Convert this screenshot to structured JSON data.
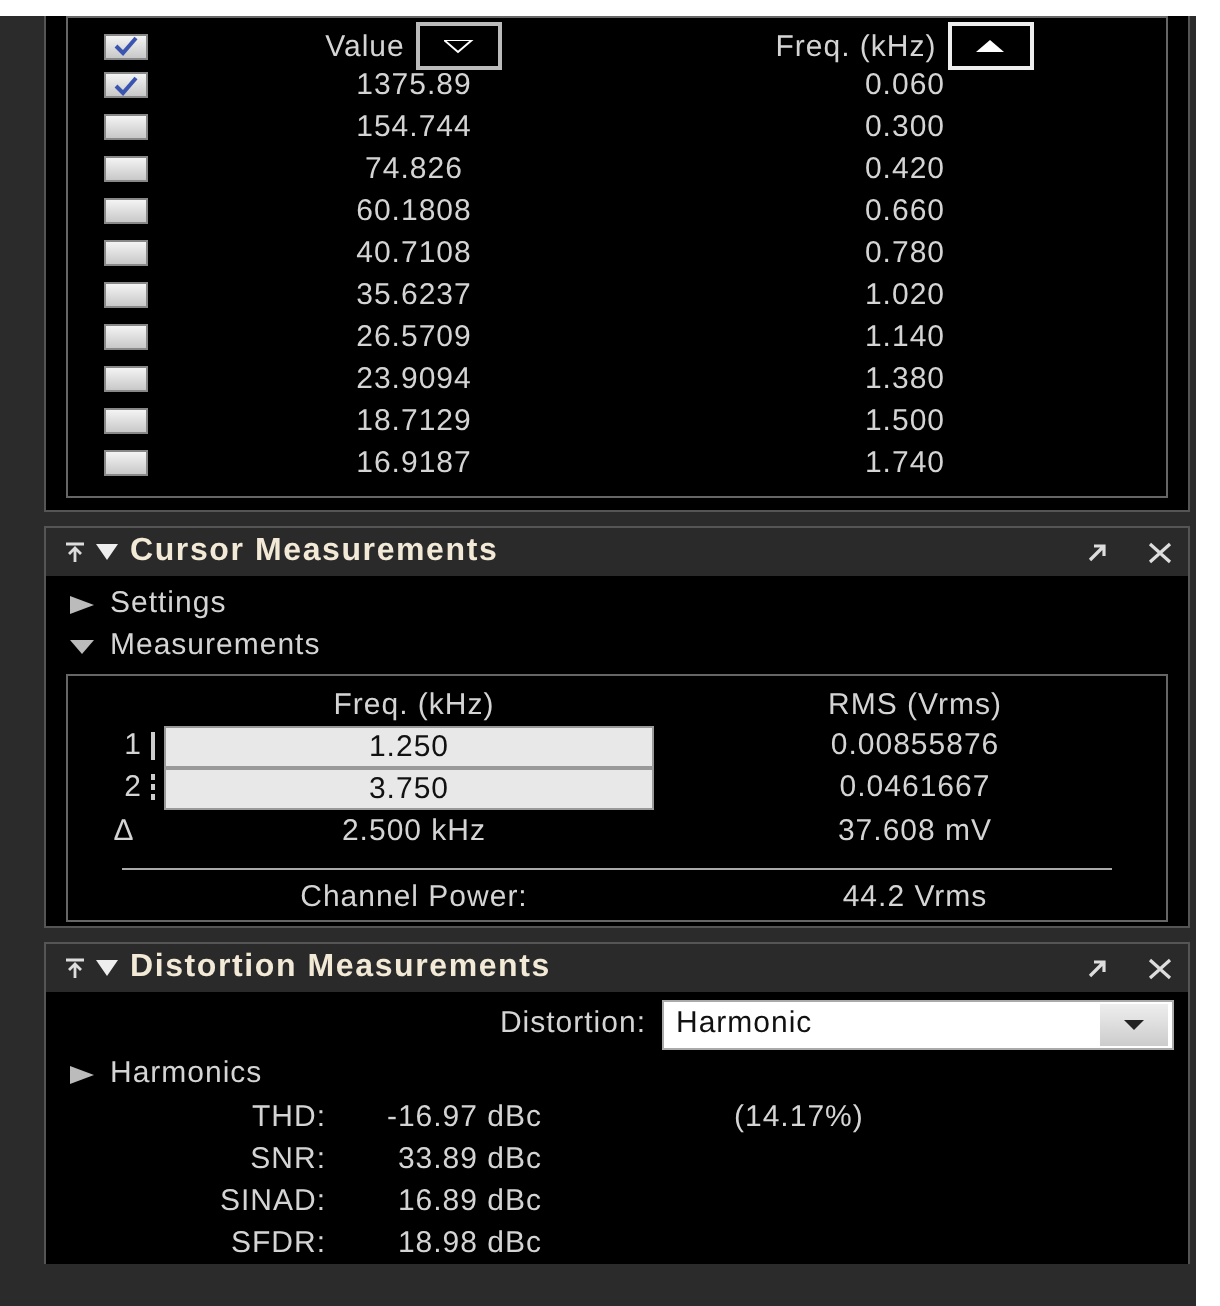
{
  "peaks": {
    "all_checked": true,
    "columns": [
      {
        "label": "Value",
        "kind": "descending",
        "active": false
      },
      {
        "label": "Freq. (kHz)",
        "kind": "ascending",
        "active": true
      }
    ],
    "rows": [
      {
        "checked": true,
        "value": "1375.89",
        "freq": "0.060"
      },
      {
        "checked": false,
        "value": "154.744",
        "freq": "0.300"
      },
      {
        "checked": false,
        "value": "74.826",
        "freq": "0.420"
      },
      {
        "checked": false,
        "value": "60.1808",
        "freq": "0.660"
      },
      {
        "checked": false,
        "value": "40.7108",
        "freq": "0.780"
      },
      {
        "checked": false,
        "value": "35.6237",
        "freq": "1.020"
      },
      {
        "checked": false,
        "value": "26.5709",
        "freq": "1.140"
      },
      {
        "checked": false,
        "value": "23.9094",
        "freq": "1.380"
      },
      {
        "checked": false,
        "value": "18.7129",
        "freq": "1.500"
      },
      {
        "checked": false,
        "value": "16.9187",
        "freq": "1.740"
      }
    ]
  },
  "cursor_panel": {
    "title": "Cursor Measurements",
    "expanded": true,
    "sections": [
      {
        "label": "Settings",
        "expanded": false
      },
      {
        "label": "Measurements",
        "expanded": true
      }
    ],
    "columns": [
      "Freq. (kHz)",
      "RMS (Vrms)"
    ],
    "cursors": [
      {
        "label": "1",
        "kind": "solid",
        "freq": "1.250",
        "rms": "0.00855876"
      },
      {
        "label": "2",
        "kind": "dashed",
        "freq": "3.750",
        "rms": "0.0461667"
      }
    ],
    "delta": {
      "symbol": "Δ",
      "freq": "2.500 kHz",
      "rms": "37.608 mV"
    },
    "channel_power": {
      "label": "Channel Power:",
      "value": "44.2 Vrms"
    }
  },
  "distortion_panel": {
    "title": "Distortion Measurements",
    "expanded": true,
    "distortion": {
      "label": "Distortion:",
      "value": "Harmonic"
    },
    "sections": [
      {
        "label": "Harmonics",
        "expanded": false
      }
    ],
    "metrics": [
      {
        "label": "THD:",
        "value": "-16.97 dBc",
        "extra": "(14.17%)"
      },
      {
        "label": "SNR:",
        "value": "33.89 dBc"
      },
      {
        "label": "SINAD:",
        "value": "16.89 dBc"
      },
      {
        "label": "SFDR:",
        "value": "18.98 dBc"
      }
    ]
  }
}
